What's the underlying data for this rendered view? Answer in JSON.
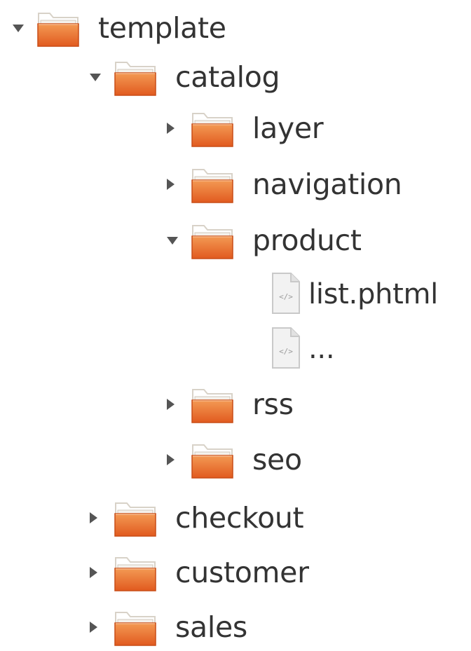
{
  "tree": [
    {
      "label": "template",
      "type": "folder",
      "level": 0,
      "state": "expanded"
    },
    {
      "label": "catalog",
      "type": "folder",
      "level": 1,
      "state": "expanded"
    },
    {
      "label": "layer",
      "type": "folder",
      "level": 2,
      "state": "collapsed"
    },
    {
      "label": "navigation",
      "type": "folder",
      "level": 2,
      "state": "collapsed"
    },
    {
      "label": "product",
      "type": "folder",
      "level": 2,
      "state": "expanded"
    },
    {
      "label": "list.phtml",
      "type": "file",
      "level": 3,
      "state": "none"
    },
    {
      "label": "...",
      "type": "file",
      "level": 3,
      "state": "none"
    },
    {
      "label": "rss",
      "type": "folder",
      "level": 2,
      "state": "collapsed"
    },
    {
      "label": "seo",
      "type": "folder",
      "level": 2,
      "state": "collapsed"
    },
    {
      "label": "checkout",
      "type": "folder",
      "level": 1,
      "state": "collapsed"
    },
    {
      "label": "customer",
      "type": "folder",
      "level": 1,
      "state": "collapsed"
    },
    {
      "label": "sales",
      "type": "folder",
      "level": 1,
      "state": "collapsed"
    }
  ],
  "colors": {
    "folder_front_top": "#f39a54",
    "folder_front_bottom": "#e15a1f",
    "folder_back": "#d8d2c8",
    "toggle": "#555555",
    "text": "#333333"
  },
  "icons": {
    "folder": "folder-icon",
    "file": "code-file-icon"
  }
}
